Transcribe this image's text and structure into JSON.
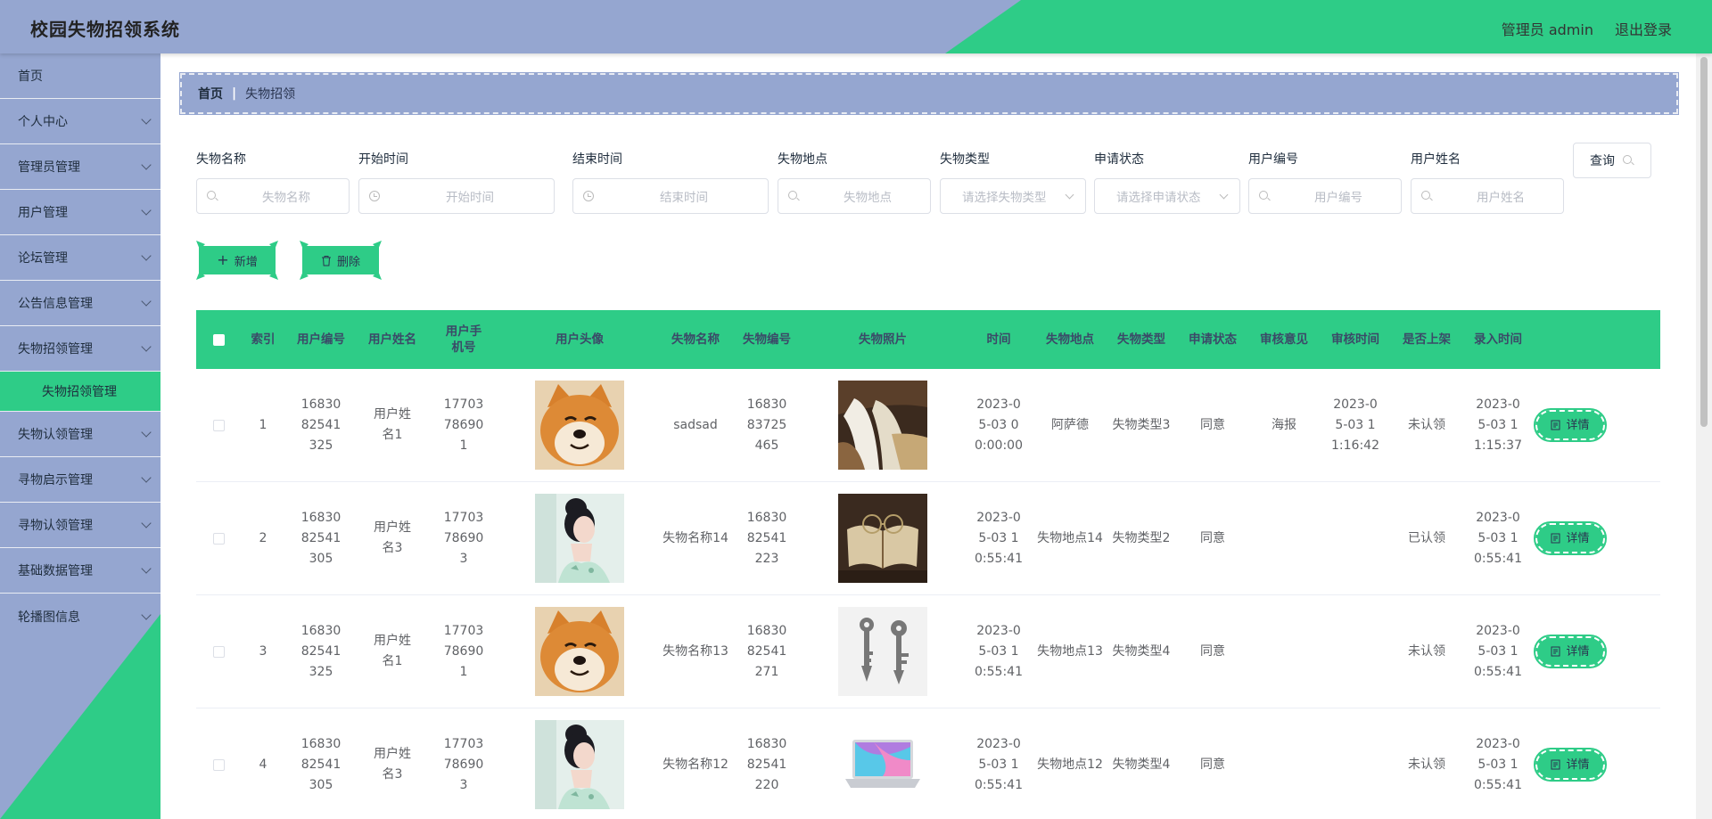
{
  "header": {
    "title": "校园失物招领系统",
    "admin_label": "管理员 admin",
    "logout_label": "退出登录"
  },
  "sidebar": {
    "items": [
      {
        "label": "首页"
      },
      {
        "label": "个人中心"
      },
      {
        "label": "管理员管理"
      },
      {
        "label": "用户管理"
      },
      {
        "label": "论坛管理"
      },
      {
        "label": "公告信息管理"
      },
      {
        "label": "失物招领管理"
      },
      {
        "label": "失物认领管理"
      },
      {
        "label": "寻物启示管理"
      },
      {
        "label": "寻物认领管理"
      },
      {
        "label": "基础数据管理"
      },
      {
        "label": "轮播图信息"
      }
    ],
    "active_sub": "失物招领管理"
  },
  "breadcrumb": {
    "home": "首页",
    "sep": "|",
    "current": "失物招领"
  },
  "search": {
    "fields": [
      {
        "label": "失物名称",
        "placeholder": "失物名称"
      },
      {
        "label": "开始时间",
        "placeholder": "开始时间"
      },
      {
        "label": "结束时间",
        "placeholder": "结束时间"
      },
      {
        "label": "失物地点",
        "placeholder": "失物地点"
      },
      {
        "label": "失物类型",
        "placeholder": "请选择失物类型"
      },
      {
        "label": "申请状态",
        "placeholder": "请选择申请状态"
      },
      {
        "label": "用户编号",
        "placeholder": "用户编号"
      },
      {
        "label": "用户姓名",
        "placeholder": "用户姓名"
      }
    ],
    "query_label": "查询"
  },
  "actions": {
    "add_label": "新增",
    "delete_label": "删除"
  },
  "table": {
    "headers": [
      "索引",
      "用户编号",
      "用户姓名",
      "用户手机号",
      "用户头像",
      "失物名称",
      "失物编号",
      "失物照片",
      "时间",
      "失物地点",
      "失物类型",
      "申请状态",
      "审核意见",
      "审核时间",
      "是否上架",
      "录入时间"
    ],
    "detail_label": "详情",
    "rows": [
      {
        "index": "1",
        "user_no": "1683082541325",
        "user_name": "用户姓名1",
        "phone": "17703786901",
        "avatar": "shiba-dog",
        "item_name": "sadsad",
        "item_no": "1683083725465",
        "photo": "waterfall",
        "time": "2023-05-03 00:00:00",
        "place": "阿萨德",
        "type": "失物类型3",
        "status": "同意",
        "opinion": "海报",
        "review_time": "2023-05-03 11:16:42",
        "listed": "未认领",
        "entry_time": "2023-05-03 11:15:37"
      },
      {
        "index": "2",
        "user_no": "1683082541305",
        "user_name": "用户姓名3",
        "phone": "17703786903",
        "avatar": "woman-portrait",
        "item_name": "失物名称14",
        "item_no": "1683082541223",
        "photo": "book-glasses",
        "time": "2023-05-03 10:55:41",
        "place": "失物地点14",
        "type": "失物类型2",
        "status": "同意",
        "opinion": "",
        "review_time": "",
        "listed": "已认领",
        "entry_time": "2023-05-03 10:55:41"
      },
      {
        "index": "3",
        "user_no": "1683082541325",
        "user_name": "用户姓名1",
        "phone": "17703786901",
        "avatar": "shiba-dog",
        "item_name": "失物名称13",
        "item_no": "1683082541271",
        "photo": "keys",
        "time": "2023-05-03 10:55:41",
        "place": "失物地点13",
        "type": "失物类型4",
        "status": "同意",
        "opinion": "",
        "review_time": "",
        "listed": "未认领",
        "entry_time": "2023-05-03 10:55:41"
      },
      {
        "index": "4",
        "user_no": "1683082541305",
        "user_name": "用户姓名3",
        "phone": "17703786903",
        "avatar": "woman-portrait",
        "item_name": "失物名称12",
        "item_no": "1683082541220",
        "photo": "laptop",
        "time": "2023-05-03 10:55:41",
        "place": "失物地点12",
        "type": "失物类型4",
        "status": "同意",
        "opinion": "",
        "review_time": "",
        "listed": "未认领",
        "entry_time": "2023-05-03 10:55:41"
      }
    ]
  },
  "colors": {
    "accent_green": "#2ecc87",
    "accent_blue": "#95a6d0"
  }
}
